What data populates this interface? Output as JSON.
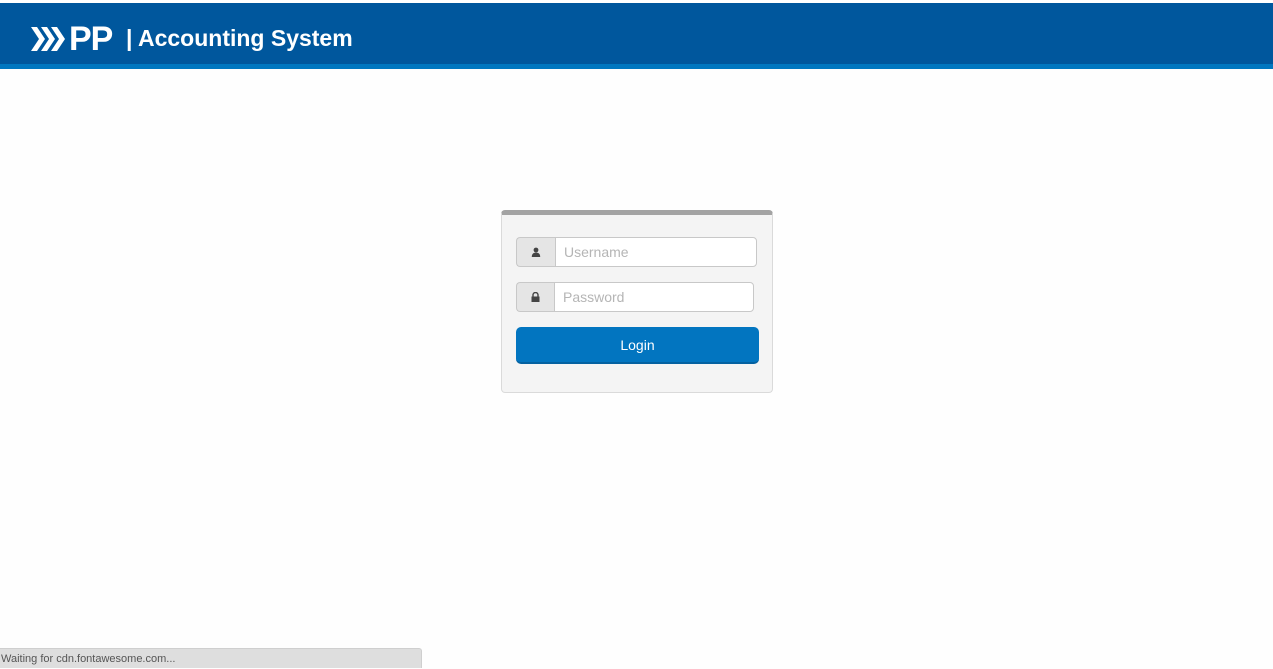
{
  "header": {
    "logo_text": "PP",
    "title": "| Accounting System"
  },
  "login": {
    "username_placeholder": "Username",
    "password_placeholder": "Password",
    "login_label": "Login",
    "username_icon": "user-icon",
    "password_icon": "lock-icon"
  },
  "status": {
    "text": "Waiting for cdn.fontawesome.com..."
  },
  "colors": {
    "header_bg": "#00579d",
    "header_accent": "#0077c0",
    "button": "#0275c0",
    "box_top_border": "#a3a3a3"
  }
}
